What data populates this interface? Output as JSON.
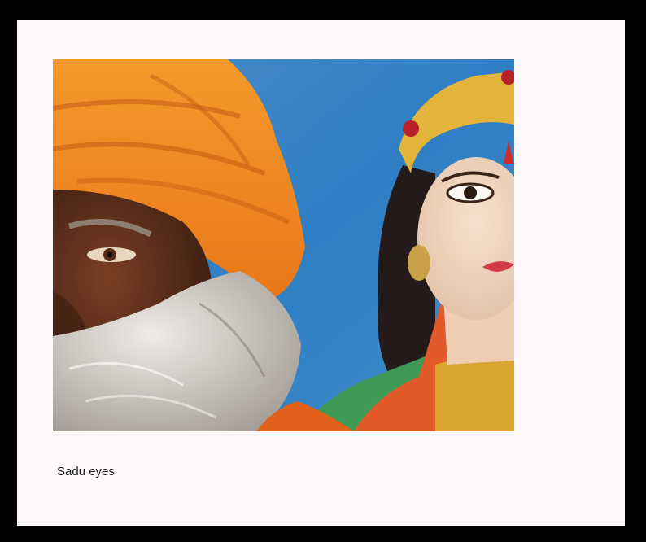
{
  "caption": "Sadu eyes",
  "colors": {
    "outer_border": "#000000",
    "mat": "#fdf9fa",
    "turban": "#f08a1e",
    "wall": "#3f86c4",
    "skin": "#5a2e1c",
    "beard": "#d9d6d2"
  },
  "photo": {
    "subject": "photo-sadhu-and-goddess-painting"
  }
}
